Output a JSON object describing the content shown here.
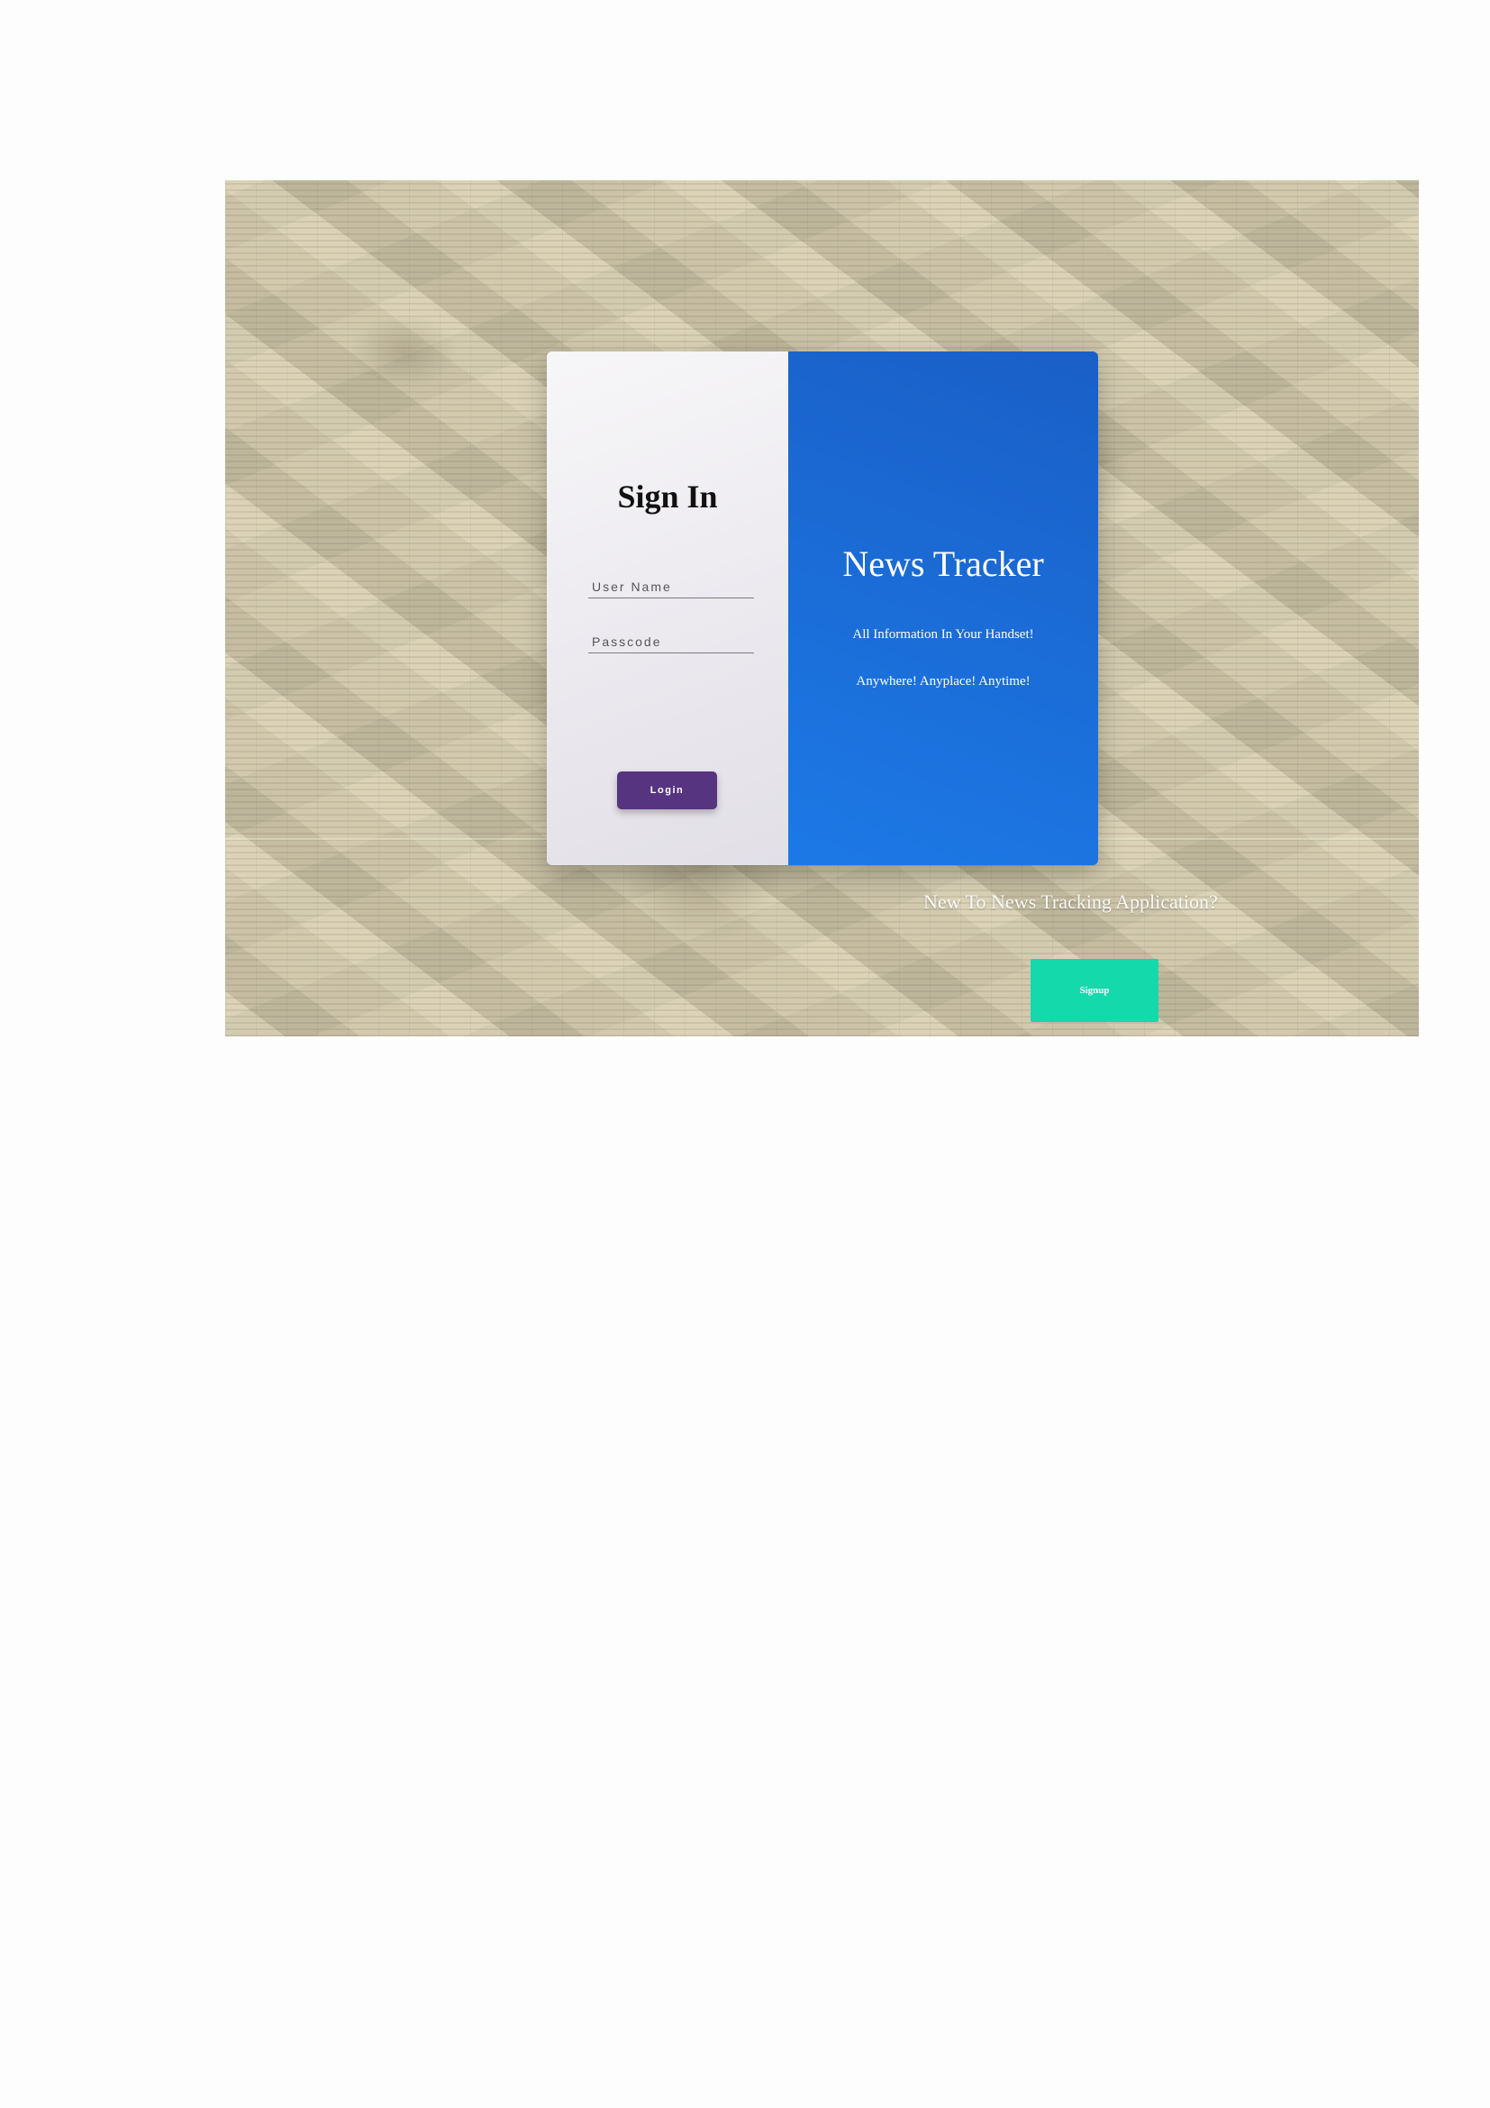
{
  "signin": {
    "title": "Sign In",
    "username_placeholder": "User Name",
    "passcode_placeholder": "Passcode",
    "login_label": "Login"
  },
  "brand": {
    "title": "News Tracker",
    "tagline_1": "All Information In Your Handset!",
    "tagline_2": "Anywhere! Anyplace! Anytime!"
  },
  "signup": {
    "prompt": "New To News Tracking Application?",
    "button_label": "Signup"
  },
  "colors": {
    "login_button": "#573480",
    "brand_panel": "#1c79e6",
    "signup_button": "#13d9ab"
  }
}
